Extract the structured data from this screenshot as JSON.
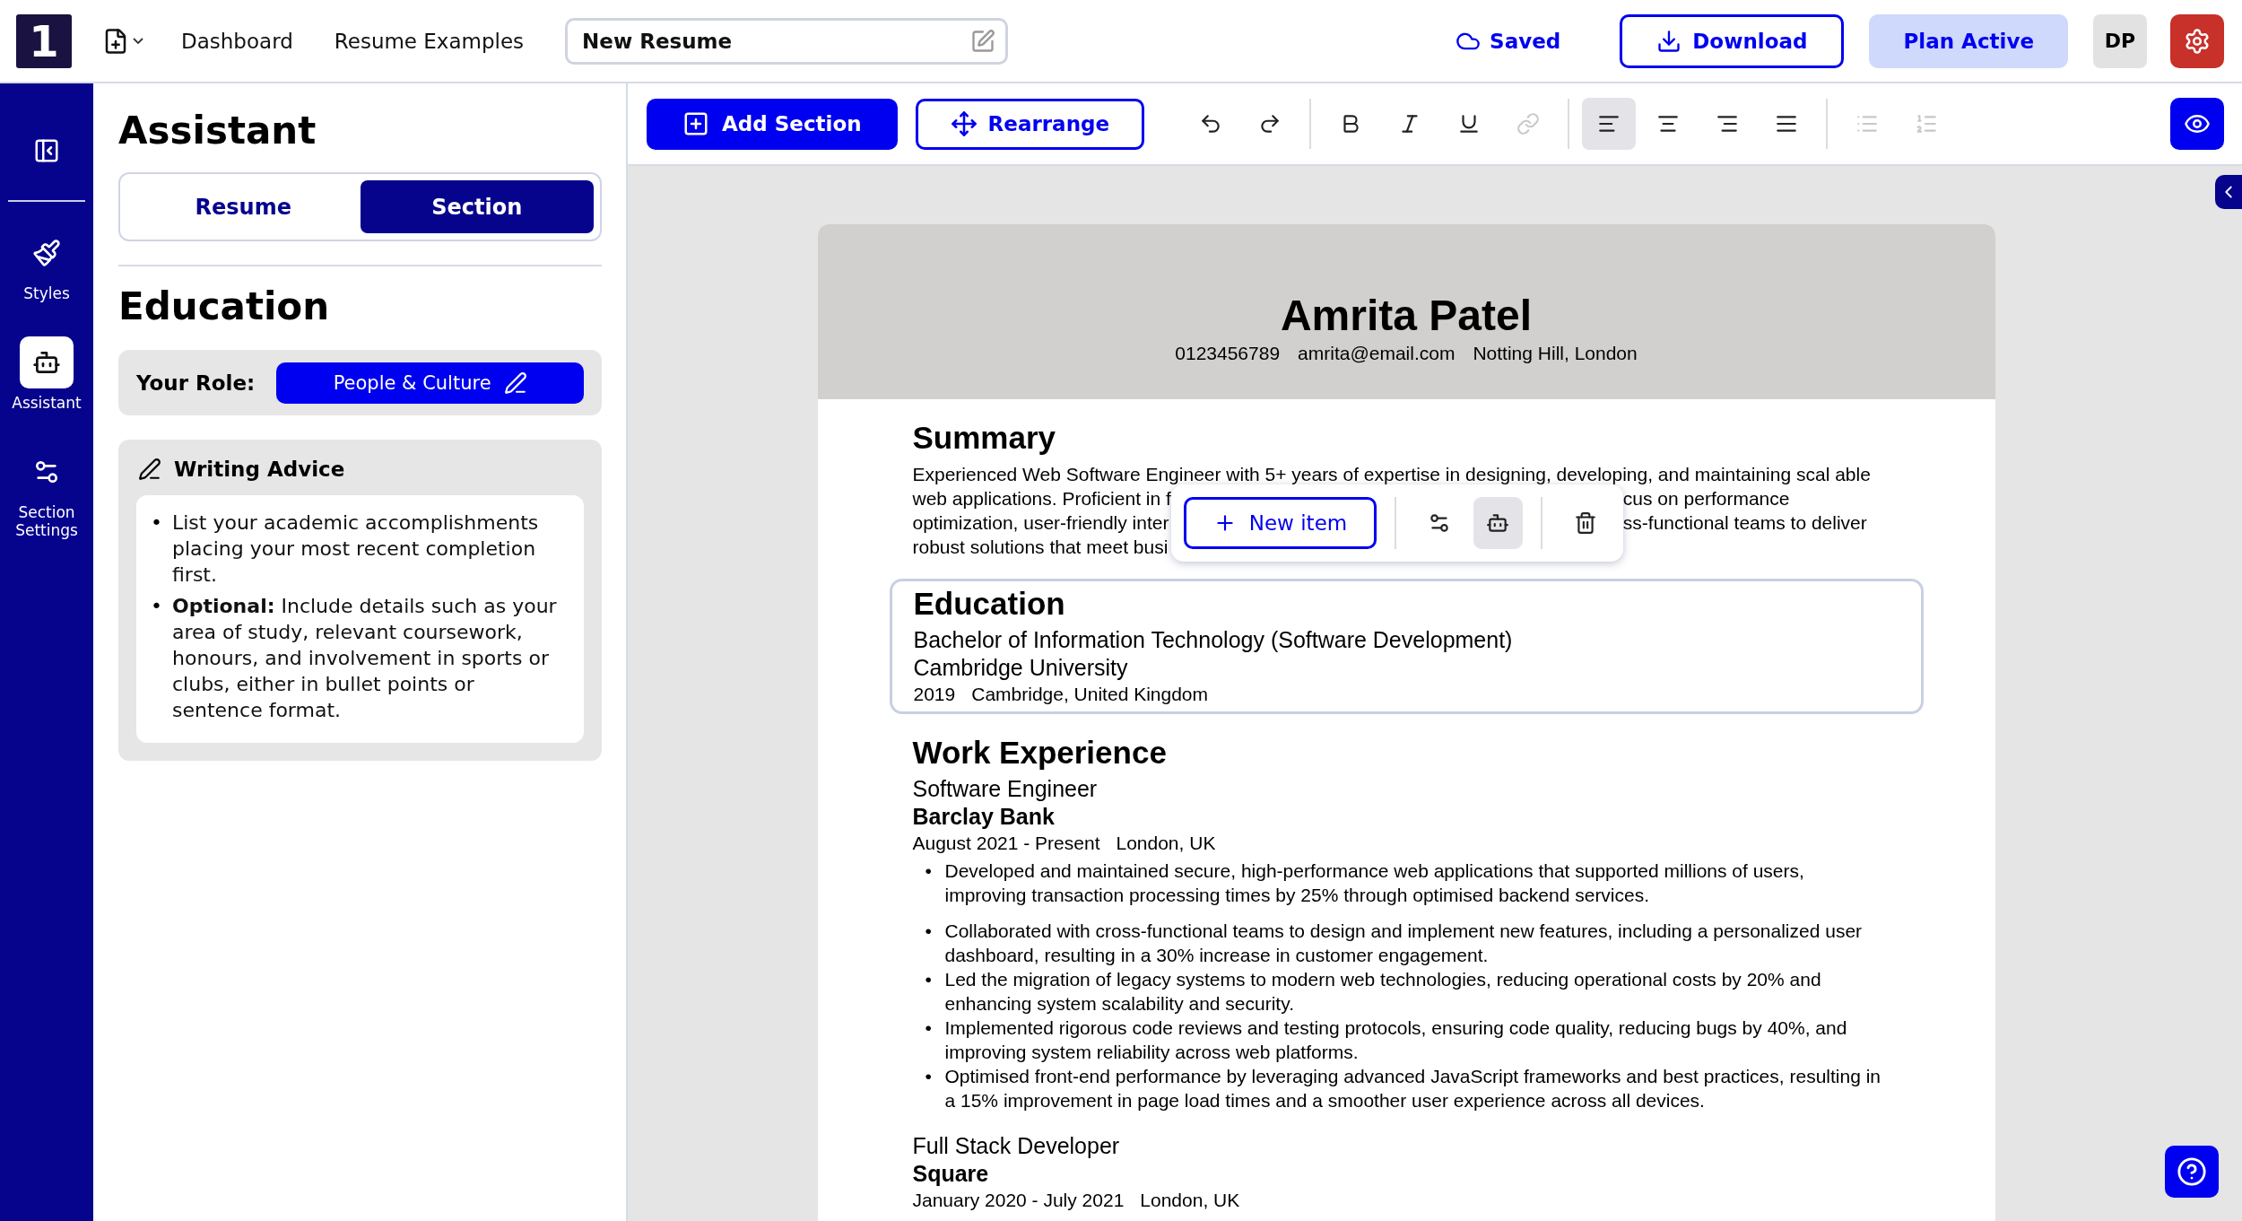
{
  "top_bar": {
    "logo": "1",
    "nav": [
      "Dashboard",
      "Resume Examples"
    ],
    "document_title": {
      "value": "New Resume"
    },
    "status": "Saved",
    "download": "Download",
    "plan": "Plan Active",
    "avatar": "DP"
  },
  "left_rail": [
    {
      "kind": "styles",
      "label": "Styles",
      "selected": false
    },
    {
      "kind": "assistant",
      "label": "Assistant",
      "selected": true
    },
    {
      "kind": "settings",
      "label": "Section Settings",
      "selected": false
    }
  ],
  "panel": {
    "title": "Assistant",
    "tabs": [
      {
        "label": "Resume",
        "selected": false
      },
      {
        "label": "Section",
        "selected": true
      }
    ],
    "section_title": "Education",
    "role_label": "Your Role:",
    "role_value": "People & Culture",
    "advice_title": "Writing Advice",
    "advice": [
      {
        "marker": "•",
        "text": "List your academic accomplishments placing your most recent completion first."
      },
      {
        "marker": "•",
        "text": "**Optional:** Include details such as your area of study, relevant coursework, honours, and involvement in sports or clubs, either in bullet points or sentence format."
      }
    ]
  },
  "toolbar": {
    "add_section": "Add Section",
    "rearrange": "Rearrange",
    "tool_groups": [
      [
        {
          "kind": "undo",
          "selected": false,
          "disabled": false
        },
        {
          "kind": "redo",
          "selected": false,
          "disabled": false
        }
      ],
      [
        {
          "kind": "bold",
          "selected": false,
          "disabled": false
        },
        {
          "kind": "italic",
          "selected": false,
          "disabled": false
        },
        {
          "kind": "underline",
          "selected": false,
          "disabled": false
        },
        {
          "kind": "link",
          "selected": false,
          "disabled": true
        }
      ],
      [
        {
          "kind": "align-left",
          "selected": true,
          "disabled": false
        },
        {
          "kind": "align-center",
          "selected": false,
          "disabled": false
        },
        {
          "kind": "align-right",
          "selected": false,
          "disabled": false
        },
        {
          "kind": "justify",
          "selected": false,
          "disabled": false
        }
      ],
      [
        {
          "kind": "bullets",
          "selected": false,
          "disabled": true
        },
        {
          "kind": "numbers",
          "selected": false,
          "disabled": true
        }
      ]
    ]
  },
  "resume": {
    "name": "Amrita Patel",
    "contacts": [
      "0123456789",
      "amrita@email.com",
      "Notting Hill, London"
    ],
    "summary": {
      "heading": "Summary",
      "first_line": "Experienced Web Software Engineer with 5+ years of expertise in designing, developing, and maintaining scal able",
      "lines": [
        {
          "left": "web applications. Proficient in f",
          "right": "cus on performance"
        },
        {
          "left": "optimization, user-friendly inter",
          "right": "ss-functional teams to deliver"
        },
        {
          "left": "robust solutions that meet busi"
        }
      ]
    },
    "item_popup": {
      "new_item": "New item",
      "actions": [
        {
          "kind": "settings",
          "selected": false
        },
        {
          "kind": "assistant",
          "selected": true
        },
        {
          "kind": "delete",
          "selected": false
        }
      ]
    },
    "education": {
      "heading": "Education",
      "selected": true,
      "degree": "Bachelor of Information Technology (Software Development)",
      "school": "Cambridge University",
      "year": "2019",
      "location": "Cambridge, United Kingdom"
    },
    "work": {
      "heading": "Work Experience",
      "jobs": [
        {
          "title": "Software Engineer",
          "company": "Barclay Bank",
          "dates": "August 2021 - Present",
          "location": "London, UK",
          "bullets": [
            {
              "marker": "•",
              "text": "Developed and maintained secure, high-performance web applications that supported millions of users, improving transaction processing times by 25% through optimised backend services."
            },
            {
              "marker": "•",
              "text": "Collaborated with cross-functional teams to design and implement new features, including a personalized user dashboard, resulting in a 30% increase in customer engagement."
            },
            {
              "marker": "•",
              "text": "Led the migration of legacy systems to modern web technologies, reducing operational costs by 20% and enhancing system scalability and security."
            },
            {
              "marker": "•",
              "text": "Implemented rigorous code reviews and testing protocols, ensuring code quality, reducing bugs by 40%, and improving system reliability across web platforms."
            },
            {
              "marker": "•",
              "text": "Optimised front-end performance by leveraging advanced JavaScript frameworks and best practices, resulting in a 15% improvement in page load times and a smoother user experience across all devices."
            }
          ]
        },
        {
          "title": "Full Stack Developer",
          "company": "Square",
          "dates": "January 2020 - July 2021",
          "location": "London, UK"
        }
      ]
    }
  }
}
